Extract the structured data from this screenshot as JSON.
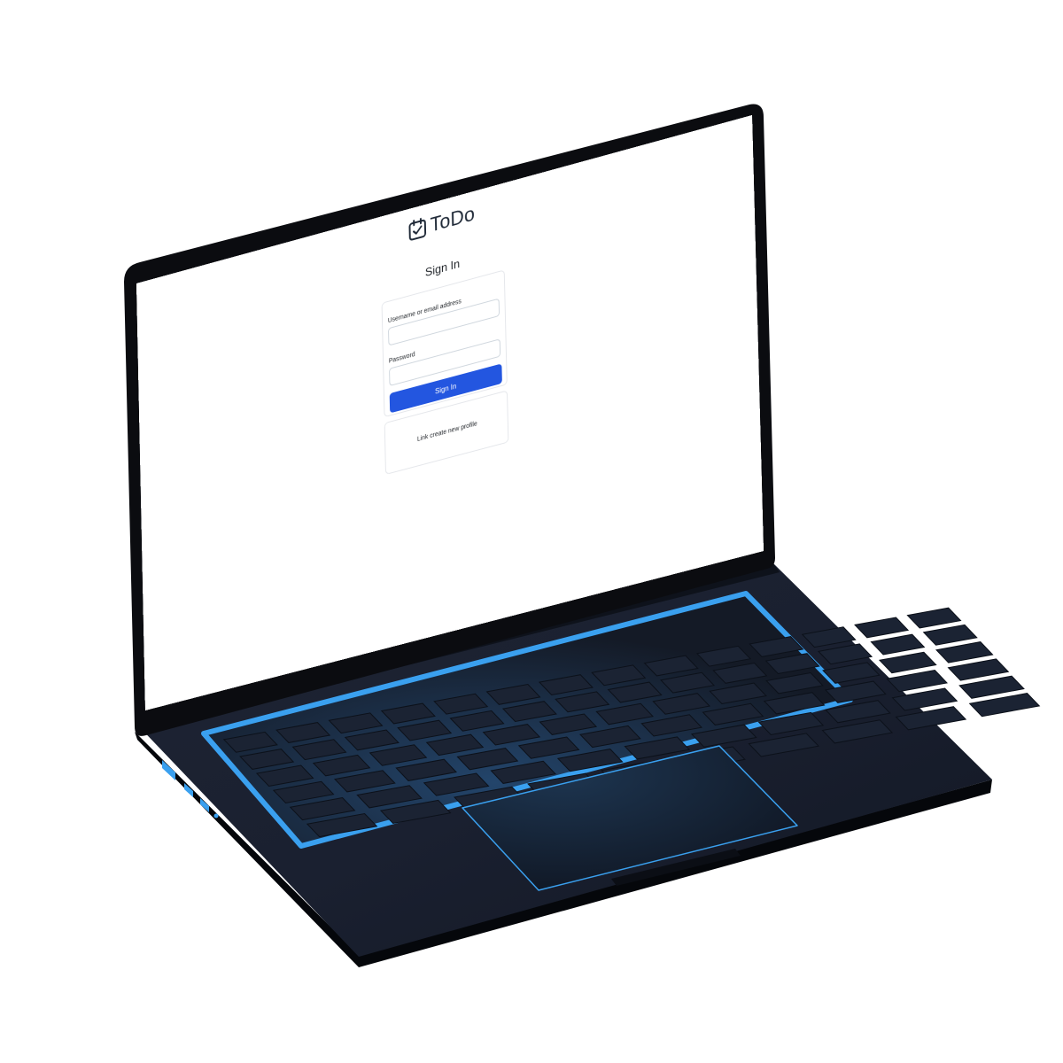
{
  "app": {
    "logo_text": "ToDo"
  },
  "page": {
    "title": "Sign In"
  },
  "signin_form": {
    "username_label": "Username or email address",
    "username_value": "",
    "password_label": "Password",
    "password_value": "",
    "submit_label": "Sign In"
  },
  "create_profile": {
    "link_text": "Link create new profile"
  },
  "colors": {
    "primary": "#2356e0",
    "keyboard_glow": "#3aa0ef",
    "laptop_body": "#161b27"
  },
  "icons": {
    "logo": "calendar-check-icon"
  }
}
